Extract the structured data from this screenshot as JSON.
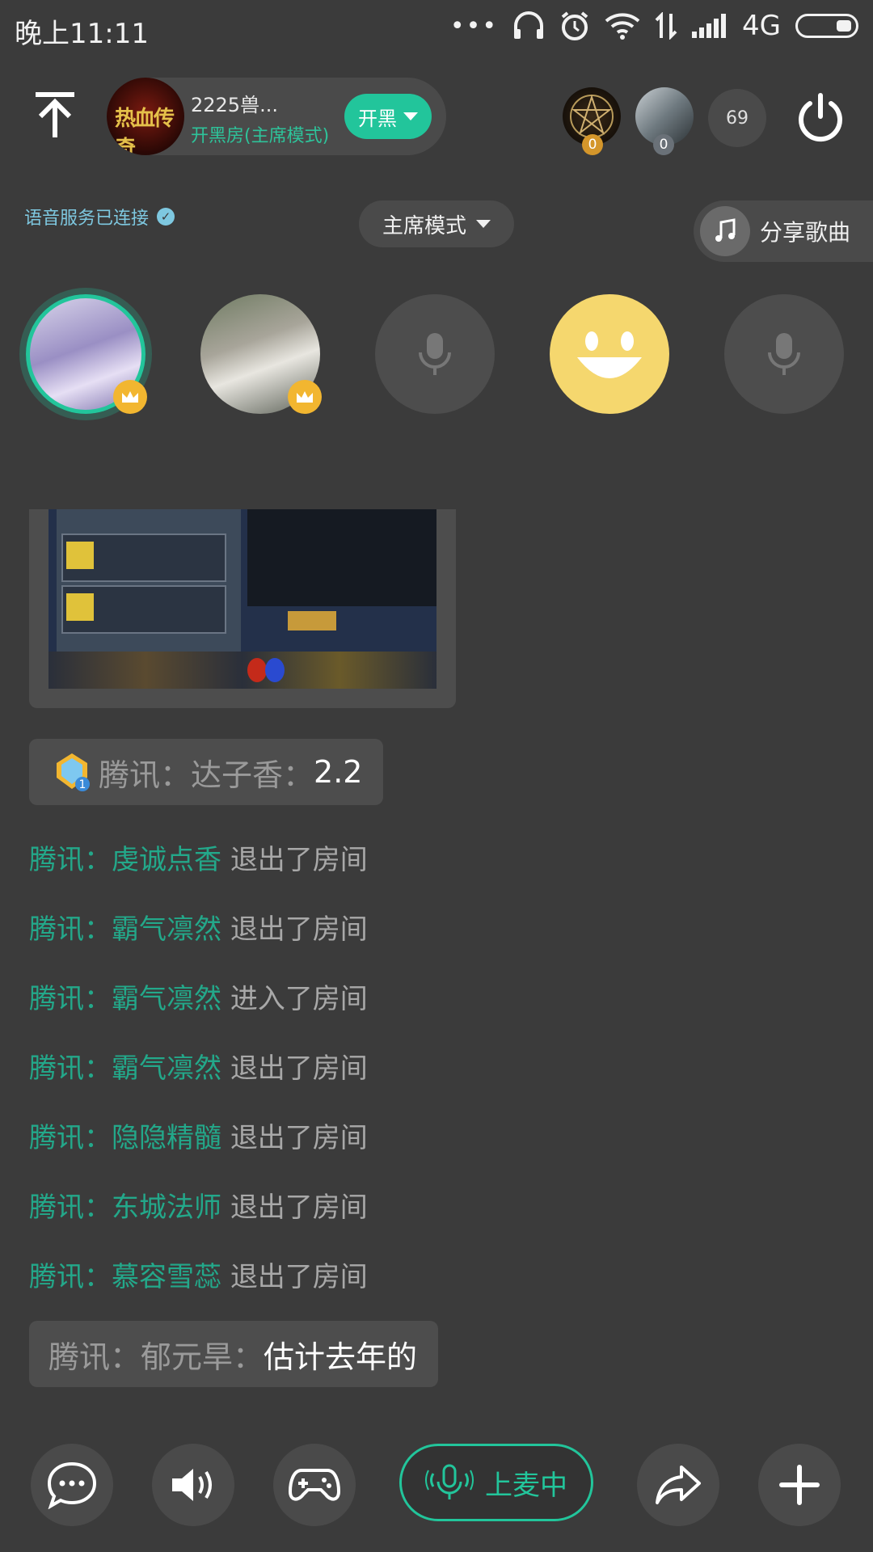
{
  "status_bar": {
    "time": "晚上11:11",
    "network": "4G"
  },
  "header": {
    "room_name": "2225兽...",
    "room_mode": "开黑房(主席模式)",
    "kaihei_label": "开黑",
    "logo_text": "热血传奇",
    "top_users": [
      {
        "count": "0"
      },
      {
        "count": "0"
      }
    ],
    "online_count": "69"
  },
  "voice": {
    "status": "语音服务已连接",
    "mode_label": "主席模式",
    "share_song_label": "分享歌曲"
  },
  "chat": {
    "bubble1": {
      "prefix": "腾讯：达子香：",
      "msg": "2.2",
      "rank": "1"
    },
    "system_prefix": "腾讯：",
    "system": [
      {
        "user": "虔诚点香",
        "action": "退出了房间"
      },
      {
        "user": "霸气凛然",
        "action": "退出了房间"
      },
      {
        "user": "霸气凛然",
        "action": "进入了房间"
      },
      {
        "user": "霸气凛然",
        "action": "退出了房间"
      },
      {
        "user": "隐隐精髓",
        "action": "退出了房间"
      },
      {
        "user": "东城法师",
        "action": "退出了房间"
      },
      {
        "user": "慕容雪蕊",
        "action": "退出了房间"
      }
    ],
    "bubble2": {
      "prefix": "腾讯：郁元旱：",
      "msg": "估计去年的"
    }
  },
  "bottom_bar": {
    "mic_label": "上麦中"
  },
  "colors": {
    "accent": "#22c59b",
    "bg": "#3b3b3b",
    "crown": "#f2b630"
  }
}
